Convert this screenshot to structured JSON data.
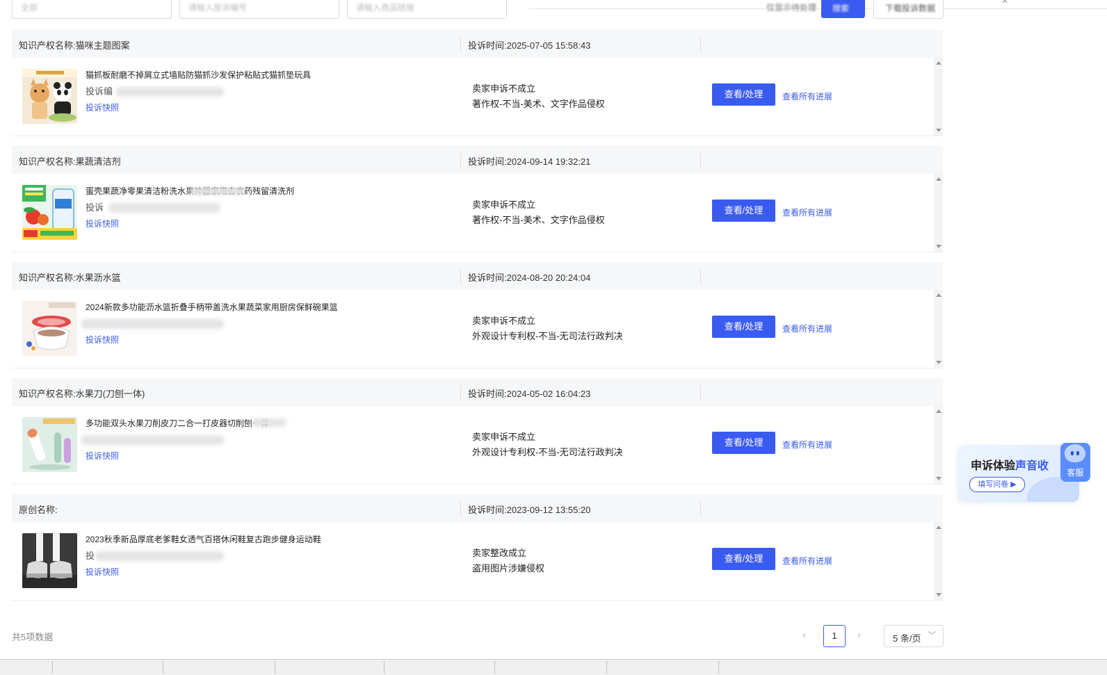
{
  "colors": {
    "primary": "#3a5bf0",
    "header_bg": "#f6f7f9",
    "text": "#333333"
  },
  "filters": {
    "field1_placeholder": "全部",
    "field2_placeholder": "请输入投诉编号",
    "field3_placeholder": "请输入商品链接",
    "checkbox_label": "仅显示待处理",
    "search_label": "搜索",
    "export_label": "下载投诉数据"
  },
  "labels": {
    "view_button": "查看/处理",
    "progress_link": "查看所有进展",
    "snapshot_link": "投诉快照"
  },
  "complaints": [
    {
      "ip_name": "知识产权名称:猫咪主题图案",
      "time": "投诉时间:2025-07-05 15:58:43",
      "product_title": "猫抓板耐磨不掉屑立式墙贴防猫抓沙发保护粘贴式猫抓垫玩具",
      "complaint_no": "投诉编",
      "status": "卖家申诉不成立",
      "reason": "著作权-不当-美术、文字作品侵权",
      "thumb": "cat"
    },
    {
      "ip_name": "知识产权名称:果蔬清洁剂",
      "time": "投诉时间:2024-09-14 19:32:21",
      "product_title": "蛋壳果蔬净零果清洁粉洗水果神器家用去农药残留清洗剂",
      "complaint_no": "投诉",
      "status": "卖家申诉不成立",
      "reason": "著作权-不当-美术、文字作品侵权",
      "thumb": "cleaner"
    },
    {
      "ip_name": "知识产权名称:水果沥水篮",
      "time": "投诉时间:2024-08-20 20:24:04",
      "product_title": "2024新款多功能沥水篮折叠手柄带盖洗水果蔬菜家用厨房保鲜碗果篮",
      "complaint_no": "",
      "status": "卖家申诉不成立",
      "reason": "外观设计专利权-不当-无司法行政判决",
      "thumb": "basket"
    },
    {
      "ip_name": "知识产权名称:水果刀(刀刨一体)",
      "time": "投诉时间:2024-05-02 16:04:23",
      "product_title": "多功能双头水果刀削皮刀二合一打皮器切削刨一体",
      "complaint_no": "",
      "status": "卖家申诉不成立",
      "reason": "外观设计专利权-不当-无司法行政判决",
      "thumb": "knife"
    },
    {
      "ip_name": "原创名称:",
      "time": "投诉时间:2023-09-12 13:55:20",
      "product_title": "2023秋季新品厚底老爹鞋女透气百搭休闲鞋复古跑步健身运动鞋",
      "complaint_no": "投",
      "status": "卖家整改成立",
      "reason": "盗用图片涉嫌侵权",
      "thumb": "shoes"
    }
  ],
  "pagination": {
    "total_text": "共5项数据",
    "current_page": "1",
    "page_size": "5 条/页"
  },
  "survey_widget": {
    "title_black": "申诉体验",
    "title_blue": "声音收",
    "fill_button": "填写问卷 ▶",
    "service_label": "客服"
  },
  "icons": {
    "prev": "chevron-left-icon",
    "next": "chevron-right-icon",
    "dropdown": "chevron-down-icon",
    "scroll_up": "scroll-up-arrow-icon",
    "scroll_down": "scroll-down-arrow-icon"
  }
}
